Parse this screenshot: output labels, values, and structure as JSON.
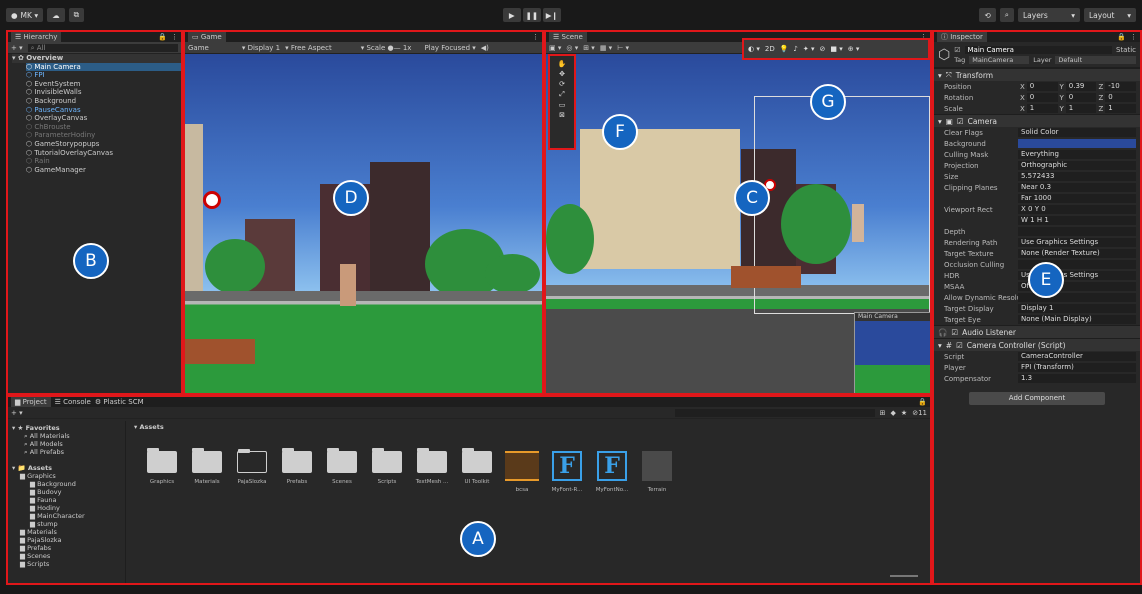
{
  "colors": {
    "highlight_border": "#e0171a",
    "badge_fill": "#1565c0",
    "selection": "#2c5d87"
  },
  "toolbar": {
    "account_label": "MK ▾",
    "cloud_icon": "cloud-icon",
    "collab_icon": "collab-icon",
    "play_icon": "▶",
    "pause_icon": "❚❚",
    "step_icon": "▶❙",
    "history_icon": "history-icon",
    "search_icon": "search-icon",
    "layers_label": "Layers",
    "layout_label": "Layout"
  },
  "hierarchy": {
    "tab": "Hierarchy",
    "add_label": "+ ▾",
    "search_placeholder": "All",
    "scene_name": "Overview",
    "items": [
      {
        "label": "Main Camera",
        "style": "sel"
      },
      {
        "label": "FPI",
        "style": "blue"
      },
      {
        "label": "EventSystem",
        "style": ""
      },
      {
        "label": "InvisibleWalls",
        "style": ""
      },
      {
        "label": "Background",
        "style": ""
      },
      {
        "label": "PauseCanvas",
        "style": "blue"
      },
      {
        "label": "OverlayCanvas",
        "style": ""
      },
      {
        "label": "ChBrouste",
        "style": "dim"
      },
      {
        "label": "ParameterHodiny",
        "style": "dim"
      },
      {
        "label": "GameStorypopups",
        "style": ""
      },
      {
        "label": "TutorialOverlayCanvas",
        "style": ""
      },
      {
        "label": "Rain",
        "style": "dim"
      },
      {
        "label": "GameManager",
        "style": ""
      }
    ]
  },
  "game": {
    "tab": "Game",
    "mode": "Game",
    "display": "Display 1",
    "aspect": "Free Aspect",
    "scale_label": "Scale",
    "scale_value": "1x",
    "play_mode": "Play Focused"
  },
  "scene": {
    "tab": "Scene",
    "mode_2d": "2D",
    "camera_preview_label": "Main Camera"
  },
  "inspector": {
    "tab": "Inspector",
    "object_name": "Main Camera",
    "static_label": "Static",
    "tag_label": "Tag",
    "tag_value": "MainCamera",
    "layer_label": "Layer",
    "layer_value": "Default",
    "transform": {
      "title": "Transform",
      "rows": [
        {
          "label": "Position",
          "x": "0",
          "y": "0.39",
          "z": "-10"
        },
        {
          "label": "Rotation",
          "x": "0",
          "y": "0",
          "z": "0"
        },
        {
          "label": "Scale",
          "x": "1",
          "y": "1",
          "z": "1"
        }
      ]
    },
    "camera": {
      "title": "Camera",
      "rows": [
        {
          "label": "Clear Flags",
          "value": "Solid Color"
        },
        {
          "label": "Background",
          "value": ""
        },
        {
          "label": "Culling Mask",
          "value": "Everything"
        },
        {
          "label": "Projection",
          "value": "Orthographic"
        },
        {
          "label": "Size",
          "value": "5.572433"
        },
        {
          "label": "Clipping Planes",
          "value": "Near  0.3"
        },
        {
          "label": "",
          "value": "Far  1000"
        },
        {
          "label": "Viewport Rect",
          "value": "X 0      Y 0"
        },
        {
          "label": "",
          "value": "W 1      H 1"
        },
        {
          "label": "Depth",
          "value": ""
        },
        {
          "label": "Rendering Path",
          "value": "Use Graphics Settings"
        },
        {
          "label": "Target Texture",
          "value": "None (Render Texture)"
        },
        {
          "label": "Occlusion Culling",
          "value": ""
        },
        {
          "label": "HDR",
          "value": "Use Graphics Settings"
        },
        {
          "label": "MSAA",
          "value": "Off"
        },
        {
          "label": "Allow Dynamic Resolu",
          "value": ""
        },
        {
          "label": "Target Display",
          "value": "Display 1"
        },
        {
          "label": "Target Eye",
          "value": "None (Main Display)"
        }
      ]
    },
    "audio_listener": "Audio Listener",
    "camera_controller": {
      "title": "Camera Controller (Script)",
      "rows": [
        {
          "label": "Script",
          "value": "CameraController"
        },
        {
          "label": "Player",
          "value": "FPI (Transform)"
        },
        {
          "label": "Compensator",
          "value": "1.3"
        }
      ]
    },
    "add_component": "Add Component"
  },
  "project": {
    "tabs": [
      "Project",
      "Console",
      "Plastic SCM"
    ],
    "add_label": "+ ▾",
    "favorites_label": "Favorites",
    "favorites": [
      "All Materials",
      "All Models",
      "All Prefabs"
    ],
    "assets_label": "Assets",
    "tree": [
      "Graphics",
      "Background",
      "Budovy",
      "Fauna",
      "Hodiny",
      "MainCharacter",
      "stump",
      "Materials",
      "PajaSlozka",
      "Prefabs",
      "Scenes",
      "Scripts"
    ],
    "breadcrumb": "Assets",
    "count": "11",
    "assets": [
      {
        "name": "Graphics",
        "kind": "folder"
      },
      {
        "name": "Materials",
        "kind": "folder"
      },
      {
        "name": "PajaSlozka",
        "kind": "folder-empty"
      },
      {
        "name": "Prefabs",
        "kind": "folder"
      },
      {
        "name": "Scenes",
        "kind": "folder"
      },
      {
        "name": "Scripts",
        "kind": "folder"
      },
      {
        "name": "TextMesh ...",
        "kind": "folder"
      },
      {
        "name": "UI Toolkit",
        "kind": "folder"
      },
      {
        "name": "bcsa",
        "kind": "audio"
      },
      {
        "name": "MyFont-R...",
        "kind": "font"
      },
      {
        "name": "MyFontNo...",
        "kind": "font"
      },
      {
        "name": "Terrain",
        "kind": "terrain"
      }
    ]
  },
  "badges": {
    "a": "A",
    "b": "B",
    "c": "C",
    "d": "D",
    "e": "E",
    "f": "F",
    "g": "G"
  }
}
